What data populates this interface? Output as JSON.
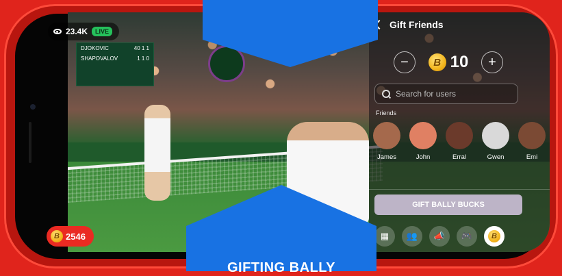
{
  "stream": {
    "viewer_count": "23.4K",
    "live_badge": "LIVE"
  },
  "wallet": {
    "coin_balance": "2546",
    "coin_symbol": "B"
  },
  "scoreboard": {
    "players": [
      {
        "name": "DJOKOVIC",
        "score": "40 1 1"
      },
      {
        "name": "SHAPOVALOV",
        "score": "1 1 0"
      }
    ]
  },
  "gift_panel": {
    "title": "Gift Friends",
    "amount": "10",
    "coin_symbol": "B",
    "search_placeholder": "Search for users",
    "friends_label": "Friends",
    "friends": [
      {
        "name": "James",
        "color": "#a5694c"
      },
      {
        "name": "John",
        "color": "#e08063"
      },
      {
        "name": "Erral",
        "color": "#6b3a2b"
      },
      {
        "name": "Gwen",
        "color": "#d9d9d9"
      },
      {
        "name": "Emi",
        "color": "#7b4a34"
      }
    ],
    "gift_button_label": "GIFT BALLY BUCKS",
    "bottom_bar_icons": [
      "grid-icon",
      "people-icon",
      "megaphone-icon",
      "gamepad-icon",
      "coin-icon"
    ]
  },
  "banner": {
    "text": "GIFTING BALLY"
  },
  "colors": {
    "brand_red": "#e0241c",
    "banner_blue": "#1872e3",
    "coin_gold": "#f3b51c",
    "live_green": "#25c05b"
  }
}
